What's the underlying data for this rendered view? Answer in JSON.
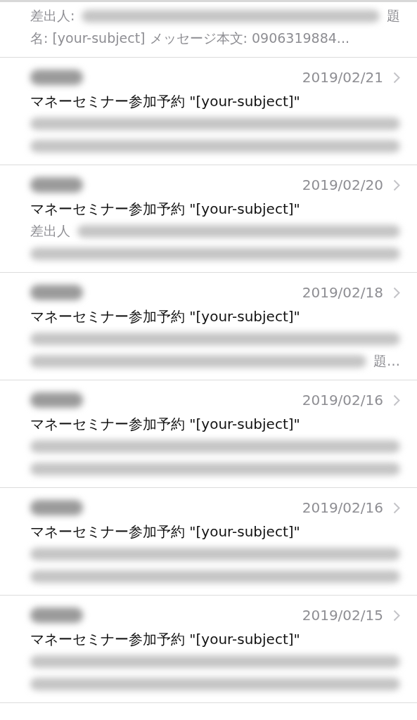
{
  "messages": [
    {
      "preview": [
        [
          {
            "kind": "text",
            "text": "差出人:"
          },
          {
            "kind": "redacted"
          },
          {
            "kind": "text",
            "text": "題"
          }
        ],
        [
          {
            "kind": "text",
            "text": "名: [your-subject] メッセージ本文: 0906319884..."
          }
        ]
      ]
    },
    {
      "sender": {
        "kind": "redacted"
      },
      "date": "2019/02/21",
      "subject": "マネーセミナー参加予約 \"[your-subject]\"",
      "preview": [
        [
          {
            "kind": "redacted"
          }
        ],
        [
          {
            "kind": "redacted"
          }
        ]
      ]
    },
    {
      "sender": {
        "kind": "redacted"
      },
      "date": "2019/02/20",
      "subject": "マネーセミナー参加予約 \"[your-subject]\"",
      "preview": [
        [
          {
            "kind": "text",
            "text": "差出人"
          },
          {
            "kind": "redacted"
          }
        ],
        [
          {
            "kind": "redacted"
          }
        ]
      ]
    },
    {
      "sender": {
        "kind": "redacted"
      },
      "date": "2019/02/18",
      "subject": "マネーセミナー参加予約 \"[your-subject]\"",
      "preview": [
        [
          {
            "kind": "redacted"
          }
        ],
        [
          {
            "kind": "redacted"
          },
          {
            "kind": "text",
            "text": "題…"
          }
        ]
      ]
    },
    {
      "sender": {
        "kind": "redacted"
      },
      "date": "2019/02/16",
      "subject": "マネーセミナー参加予約 \"[your-subject]\"",
      "preview": [
        [
          {
            "kind": "redacted"
          }
        ],
        [
          {
            "kind": "redacted"
          }
        ]
      ]
    },
    {
      "sender": {
        "kind": "redacted"
      },
      "date": "2019/02/16",
      "subject": "マネーセミナー参加予約 \"[your-subject]\"",
      "preview": [
        [
          {
            "kind": "redacted"
          }
        ],
        [
          {
            "kind": "redacted"
          }
        ]
      ]
    },
    {
      "sender": {
        "kind": "redacted"
      },
      "date": "2019/02/15",
      "subject": "マネーセミナー参加予約 \"[your-subject]\"",
      "preview": [
        [
          {
            "kind": "redacted"
          }
        ],
        [
          {
            "kind": "redacted"
          }
        ]
      ]
    }
  ]
}
